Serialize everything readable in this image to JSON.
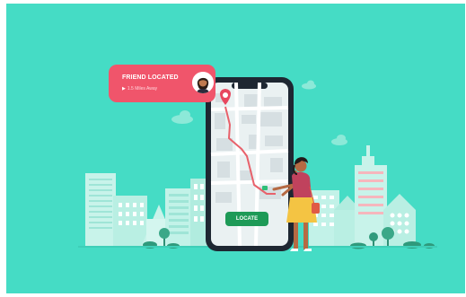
{
  "notification": {
    "title": "FRIEND LOCATED",
    "subtitle": "1.5 Miles Away"
  },
  "map": {
    "button_label": "LOCATE"
  },
  "colors": {
    "background": "#45dcc5",
    "notification": "#f0556b",
    "button": "#1e9a57",
    "route": "#e8616b",
    "buildings": "#b9efe3"
  },
  "icons": [
    "location-pin-icon",
    "play-icon",
    "avatar",
    "cloud-icon",
    "tree-icon"
  ]
}
